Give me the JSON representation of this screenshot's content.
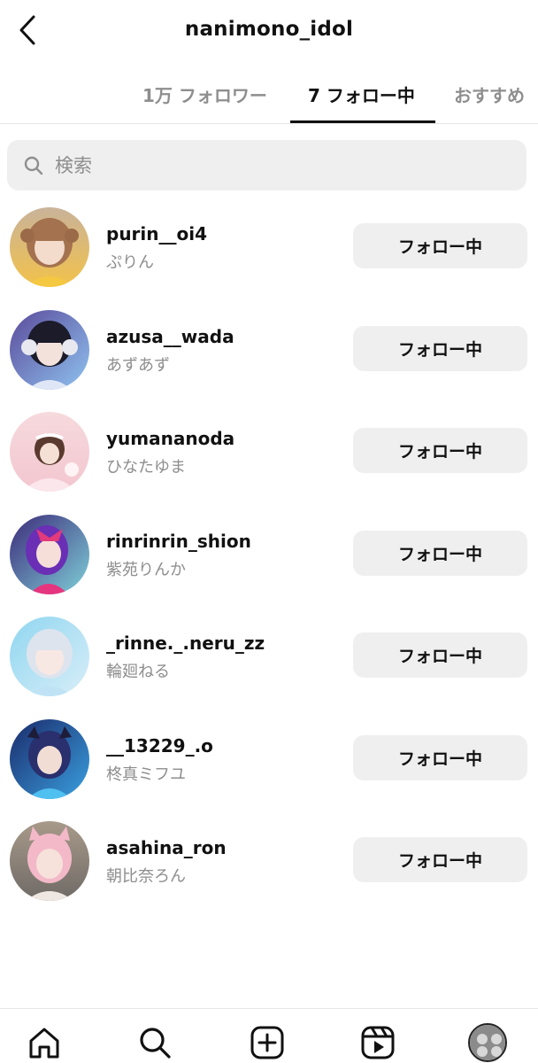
{
  "header": {
    "title": "nanimono_idol",
    "back_icon": "chevron-left-icon"
  },
  "tabs": [
    {
      "label": "1万 フォロワー",
      "active": false
    },
    {
      "label": "7 フォロー中",
      "active": true
    },
    {
      "label": "おすすめ",
      "active": false
    }
  ],
  "search": {
    "placeholder": "検索",
    "value": "",
    "icon": "search-icon"
  },
  "following": [
    {
      "username": "purin__oi4",
      "full_name": "ぷりん",
      "button_label": "フォロー中"
    },
    {
      "username": "azusa__wada",
      "full_name": "あずあず",
      "button_label": "フォロー中"
    },
    {
      "username": "yumananoda",
      "full_name": "ひなたゆま",
      "button_label": "フォロー中"
    },
    {
      "username": "rinrinrin_shion",
      "full_name": "紫苑りんか",
      "button_label": "フォロー中"
    },
    {
      "username": "_rinne._.neru_zz",
      "full_name": "輪廻ねる",
      "button_label": "フォロー中"
    },
    {
      "username": "__13229_.o",
      "full_name": "柊真ミフユ",
      "button_label": "フォロー中"
    },
    {
      "username": "asahina_ron",
      "full_name": "朝比奈ろん",
      "button_label": "フォロー中"
    }
  ],
  "bottom_nav": [
    {
      "icon": "home-icon"
    },
    {
      "icon": "search-icon"
    },
    {
      "icon": "create-post-icon"
    },
    {
      "icon": "reels-icon"
    },
    {
      "icon": "profile-avatar"
    }
  ],
  "colors": {
    "text_primary": "#111111",
    "text_secondary": "#8e8e8e",
    "button_background": "#efefef",
    "divider": "#e6e6e6"
  }
}
